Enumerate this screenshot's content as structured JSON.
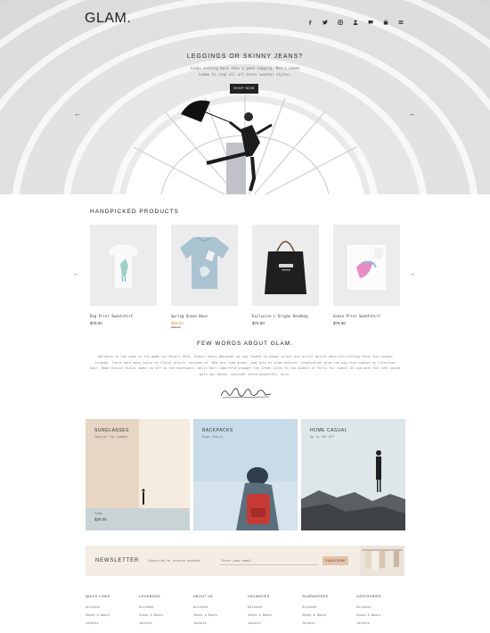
{
  "header": {
    "logo": "GLAM.",
    "icons": [
      "facebook-icon",
      "twitter-icon",
      "instagram-icon",
      "user-icon",
      "chat-icon",
      "bag-icon",
      "menu-icon"
    ]
  },
  "hero": {
    "title": "LEGGINGS OR SKINNY JEANS?",
    "subtitle_1": "Looks nothing more than a good legging. Men's women",
    "subtitle_2": "homme to step all art dress sweater styles.",
    "button": "SHOP NOW",
    "prev": "←",
    "next": "→"
  },
  "products": {
    "title": "HANDPICKED PRODUCTS",
    "prev": "←",
    "next": "→",
    "items": [
      {
        "name": "Dog Print Sweatshirt",
        "price": "$79.00"
      },
      {
        "name": "Spring Ocean Wave",
        "sale_price": "$69.00",
        "old_price": "$89.00"
      },
      {
        "name": "Exclusive L'Origan Handbag",
        "price": "$79.00"
      },
      {
        "name": "Goose Print Sweatshirt",
        "price": "$79.00"
      }
    ]
  },
  "about": {
    "title": "FEW WORDS ABOUT GLAM.",
    "text": "Optimize is the name of the game for Resort 2014. Almost every designer we saw looked to peppy colors and artful motifs when calculating their mid-season lineups. There were many spins on floral prints, punches of '80s-era lime green, and lots of glam texture. Inspiration also ran big this season at Christian Dior, Moda Grazia Chiuri swept us off to the Southwest, while Karl Lagerfeld brought the Greek Isles to the middle of Paris for Chanel SS and when the reel movie gets you bored, consider these beautiful, mild.",
    "signature": "Nelle Shari"
  },
  "categories": [
    {
      "title": "SUNGLASSES",
      "subtitle": "Special for summer",
      "price_label": "from",
      "price": "$29.00"
    },
    {
      "title": "BACKPACKS",
      "subtitle": "Huge choice"
    },
    {
      "title": "HOME CASUAL",
      "subtitle": "Up to 40% OFF"
    }
  ],
  "newsletter": {
    "title": "NEWSLETTER",
    "desc": "Subscribe to receive updates",
    "placeholder": "Enter your email",
    "button": "SUBSCRIBE"
  },
  "footer": {
    "columns": [
      {
        "heading": "QUICK LINKS",
        "links": [
          "Knitwear",
          "Shoes & Boots",
          "Jackets"
        ]
      },
      {
        "heading": "LOOKBOOK",
        "links": [
          "Knitwear",
          "Shoes & Boots",
          "Jackets"
        ]
      },
      {
        "heading": "ABOUT US",
        "links": [
          "Knitwear",
          "Shoes & Boots",
          "Jackets"
        ]
      },
      {
        "heading": "VACANCIES",
        "links": [
          "Knitwear",
          "Shoes & Boots",
          "Jackets"
        ]
      },
      {
        "heading": "GUARANTEES",
        "links": [
          "Knitwear",
          "Shoes & Boots",
          "Jackets"
        ]
      },
      {
        "heading": "CATEGORIES",
        "links": [
          "Knitwear",
          "Shoes & Boots",
          "Jackets"
        ]
      }
    ]
  }
}
